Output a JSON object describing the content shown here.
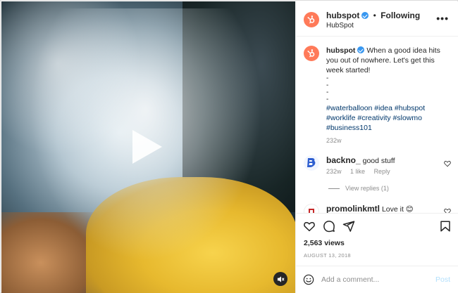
{
  "account": {
    "handle": "hubspot",
    "name": "HubSpot",
    "follow_status": "Following",
    "separator": "•"
  },
  "menu": {
    "more_label": "•••"
  },
  "caption": {
    "handle": "hubspot",
    "text": "When a good idea hits you out of nowhere. Let's get this week started!",
    "dashes": [
      "-",
      "-",
      "-",
      "-"
    ],
    "hashtags": "#waterballoon #idea #hubspot #worklife #creativity #slowmo #business101",
    "age": "232w"
  },
  "comments": [
    {
      "handle": "backno_",
      "text": "good stuff",
      "age": "232w",
      "likes": "1 like",
      "reply_label": "Reply",
      "view_replies": "View replies (1)"
    },
    {
      "handle": "promolinkmtl",
      "text": "Love it",
      "emoji": "😊"
    }
  ],
  "stats": {
    "views": "2,563 views",
    "date": "AUGUST 13, 2018"
  },
  "composer": {
    "placeholder": "Add a comment...",
    "post_label": "Post"
  },
  "colors": {
    "brand": "#ff7a59",
    "verified": "#3897f0",
    "link": "#00376b",
    "muted": "#8e8e8e"
  },
  "icons": [
    "play-icon",
    "mute-icon",
    "verified-icon",
    "more-icon",
    "heart-icon",
    "comment-icon",
    "share-icon",
    "save-icon",
    "emoji-icon"
  ]
}
